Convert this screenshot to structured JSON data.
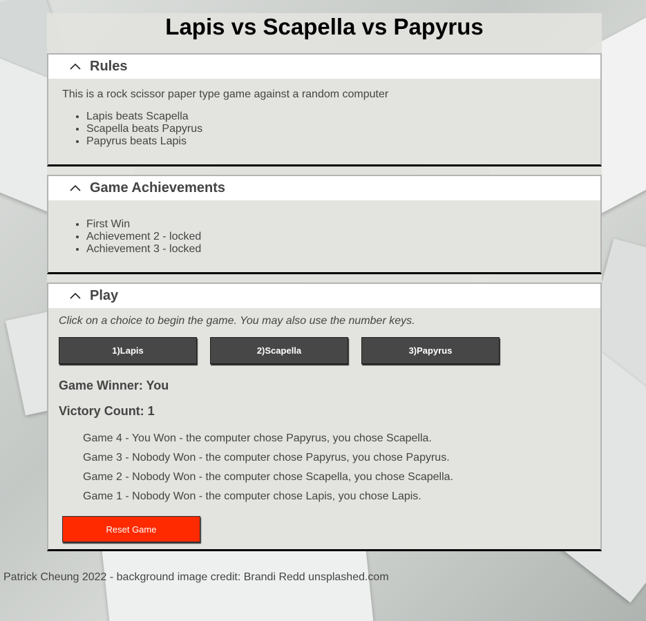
{
  "title": "Lapis vs Scapella vs Papyrus",
  "rules": {
    "heading": "Rules",
    "intro": "This is a rock scissor paper type game against a random computer",
    "items": [
      "Lapis beats Scapella",
      "Scapella beats Papyrus",
      "Papyrus beats Lapis"
    ]
  },
  "achievements": {
    "heading": "Game Achievements",
    "items": [
      "First Win",
      "Achievement 2 - locked",
      "Achievement 3 - locked"
    ]
  },
  "play": {
    "heading": "Play",
    "instructions": "Click on a choice to begin the game. You may also use the number keys.",
    "choices": [
      "1)Lapis",
      "2)Scapella",
      "3)Papyrus"
    ],
    "winner": "Game Winner: You",
    "victory_count": "Victory Count: 1",
    "history": [
      "Game 4 - You Won - the computer chose Papyrus, you chose Scapella.",
      "Game 3 - Nobody Won - the computer chose Papyrus, you chose Papyrus.",
      "Game 2 - Nobody Won - the computer chose Scapella, you chose Scapella.",
      "Game 1 - Nobody Won - the computer chose Lapis, you chose Lapis."
    ],
    "reset_label": "Reset Game"
  },
  "footer": "Patrick Cheung 2022 - background image credit: Brandi Redd unsplashed.com",
  "colors": {
    "button_dark": "#474747",
    "reset_red": "#ff2a00",
    "panel_bg": "#e3e3df"
  },
  "icons": {
    "collapse": "chevron-up-icon"
  }
}
